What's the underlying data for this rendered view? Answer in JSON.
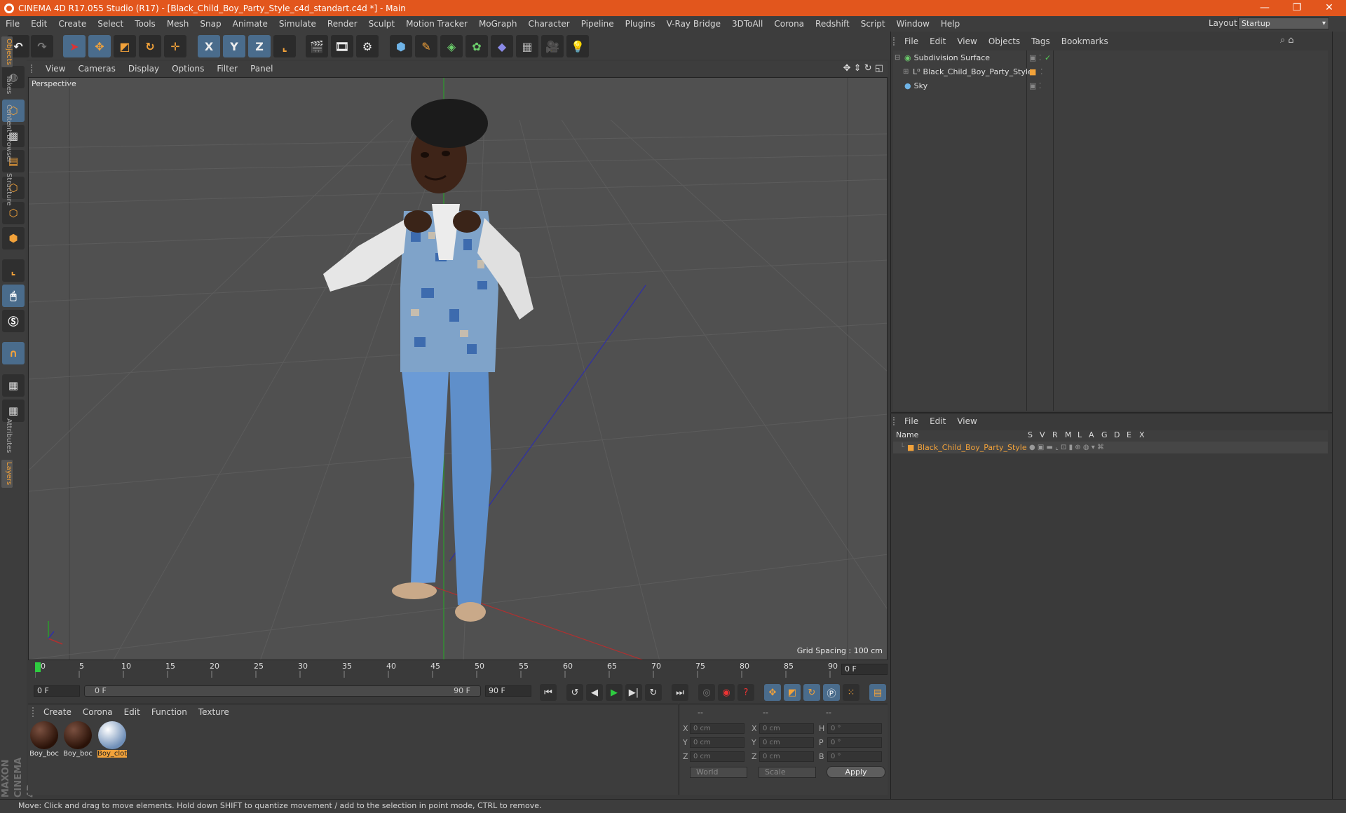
{
  "window": {
    "title": "CINEMA 4D R17.055 Studio (R17) - [Black_Child_Boy_Party_Style_c4d_standart.c4d *] - Main",
    "min": "—",
    "max": "❐",
    "close": "✕"
  },
  "menu": [
    "File",
    "Edit",
    "Create",
    "Select",
    "Tools",
    "Mesh",
    "Snap",
    "Animate",
    "Simulate",
    "Render",
    "Sculpt",
    "Motion Tracker",
    "MoGraph",
    "Character",
    "Pipeline",
    "Plugins",
    "V-Ray Bridge",
    "3DToAll",
    "Corona",
    "Redshift",
    "Script",
    "Window",
    "Help"
  ],
  "layout": {
    "label": "Layout:",
    "value": "Startup"
  },
  "toolbar": {
    "x": "X",
    "y": "Y",
    "z": "Z"
  },
  "viewport": {
    "menu": [
      "View",
      "Cameras",
      "Display",
      "Options",
      "Filter",
      "Panel"
    ],
    "label": "Perspective",
    "grid_info": "Grid Spacing : 100 cm"
  },
  "timeline": {
    "ticks": [
      "0",
      "5",
      "10",
      "15",
      "20",
      "25",
      "30",
      "35",
      "40",
      "45",
      "50",
      "55",
      "60",
      "65",
      "70",
      "75",
      "80",
      "85",
      "90"
    ],
    "current_frame": "0 F",
    "start": "0 F",
    "range_start": "0 F",
    "range_end": "90 F",
    "end": "90 F"
  },
  "materials": {
    "menu": [
      "Create",
      "Corona",
      "Edit",
      "Function",
      "Texture"
    ],
    "items": [
      "Boy_boc",
      "Boy_boc",
      "Boy_clot"
    ]
  },
  "coords": {
    "header": [
      "--",
      "--",
      "--"
    ],
    "rows": [
      {
        "a": "X",
        "av": "0 cm",
        "b": "X",
        "bv": "0 cm",
        "c": "H",
        "cv": "0 °"
      },
      {
        "a": "Y",
        "av": "0 cm",
        "b": "Y",
        "bv": "0 cm",
        "c": "P",
        "cv": "0 °"
      },
      {
        "a": "Z",
        "av": "0 cm",
        "b": "Z",
        "bv": "0 cm",
        "c": "B",
        "cv": "0 °"
      }
    ],
    "world": "World",
    "scale": "Scale",
    "apply": "Apply"
  },
  "objects": {
    "menu": [
      "File",
      "Edit",
      "View",
      "Objects",
      "Tags",
      "Bookmarks"
    ],
    "items": [
      "Subdivision Surface",
      "Black_Child_Boy_Party_Style",
      "Sky"
    ]
  },
  "layers": {
    "menu": [
      "File",
      "Edit",
      "View"
    ],
    "columns": [
      "Name",
      "S",
      "V",
      "R",
      "M",
      "L",
      "A",
      "G",
      "D",
      "E",
      "X"
    ],
    "items": [
      "Black_Child_Boy_Party_Style"
    ]
  },
  "side_tabs": [
    "Objects",
    "Takes",
    "Content Browser",
    "Structure",
    "Attributes",
    "Layers"
  ],
  "brand": "MAXON CINEMA 4D",
  "status": "Move: Click and drag to move elements. Hold down SHIFT to quantize movement / add to the selection in point mode, CTRL to remove.",
  "colors": {
    "accent": "#e2561d",
    "highlight": "#f2a23a",
    "tool_blue": "#4a6c8c"
  }
}
